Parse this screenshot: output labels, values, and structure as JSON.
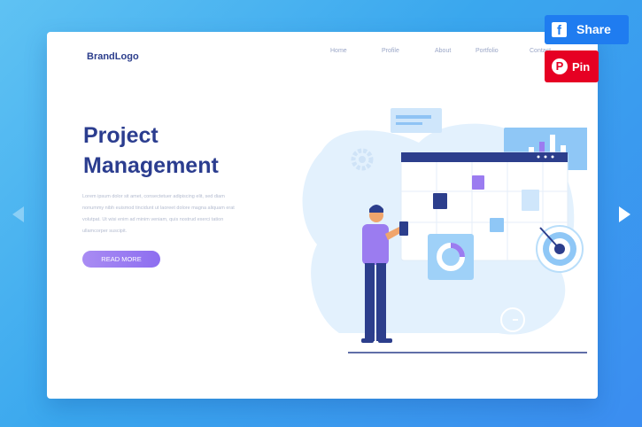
{
  "brand": "BrandLogo",
  "nav": [
    "Home",
    "Profile",
    "About",
    "Portfolio",
    "Contact"
  ],
  "hero": {
    "title_line1": "Project",
    "title_line2": "Management",
    "body": "Lorem ipsum dolor sit amet, consectetuer adipiscing elit, sed diam nonummy nibh euismod tincidunt ut laoreet dolore magna aliquam erat volutpat. Ut wisi enim ad minim veniam, quis nostrud exerci tation ullamcorper suscipit.",
    "button": "READ MORE"
  },
  "share": {
    "label": "Share",
    "icon": "f"
  },
  "pin": {
    "label": "Pin",
    "icon": "P"
  },
  "colors": {
    "accent": "#8d6ef0",
    "brand": "#2b3d8f",
    "facebook": "#1f7cf0",
    "pinterest": "#e60023"
  }
}
